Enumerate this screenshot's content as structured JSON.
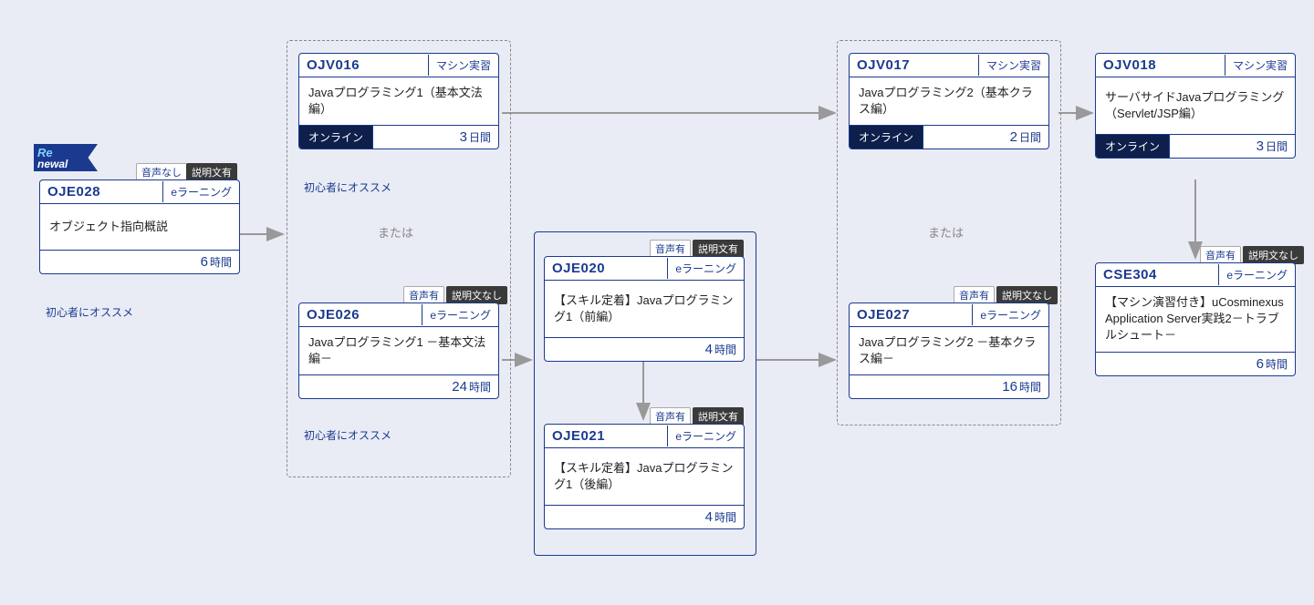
{
  "renewal": {
    "line1": "Re",
    "line2": "newal"
  },
  "badges": {
    "audio_no": "音声なし",
    "desc_yes": "説明文有",
    "audio_yes": "音声有",
    "desc_no": "説明文なし"
  },
  "labels": {
    "elearning": "eラーニング",
    "machine": "マシン実習",
    "online": "オンライン",
    "hours": "時間",
    "days": "日間",
    "or": "または",
    "recommend": "初心者にオススメ"
  },
  "courses": {
    "oje028": {
      "code": "OJE028",
      "title": "オブジェクト指向概説",
      "duration": "6"
    },
    "ojv016": {
      "code": "OJV016",
      "title": "Javaプログラミング1（基本文法編）",
      "duration": "3"
    },
    "oje026": {
      "code": "OJE026",
      "title": "Javaプログラミング1 －基本文法編－",
      "duration": "24"
    },
    "oje020": {
      "code": "OJE020",
      "title": "【スキル定着】Javaプログラミング1（前編）",
      "duration": "4"
    },
    "oje021": {
      "code": "OJE021",
      "title": "【スキル定着】Javaプログラミング1（後編）",
      "duration": "4"
    },
    "ojv017": {
      "code": "OJV017",
      "title": "Javaプログラミング2（基本クラス編）",
      "duration": "2"
    },
    "oje027": {
      "code": "OJE027",
      "title": "Javaプログラミング2 －基本クラス編－",
      "duration": "16"
    },
    "ojv018": {
      "code": "OJV018",
      "title": "サーバサイドJavaプログラミング（Servlet/JSP編）",
      "duration": "3"
    },
    "cse304": {
      "code": "CSE304",
      "title": "【マシン演習付き】uCosminexus Application Server実践2－トラブルシュート－",
      "duration": "6"
    }
  }
}
